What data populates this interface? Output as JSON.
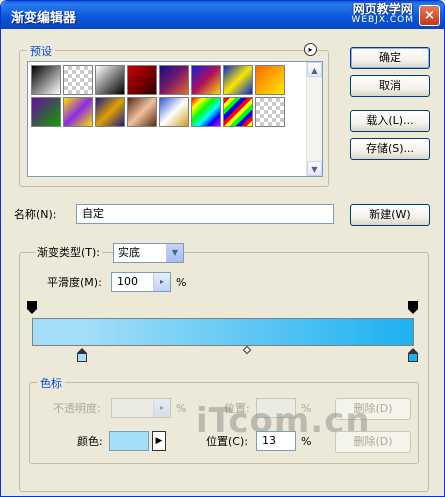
{
  "window": {
    "title": "渐变编辑器",
    "close_glyph": "×",
    "watermark_cn": "网页教学网",
    "watermark_url": "WEBJX.COM"
  },
  "presets": {
    "label": "预设",
    "menu_glyph": "▸",
    "scroll_up_glyph": "▲",
    "scroll_down_glyph": "▼",
    "swatches": [
      "linear-gradient(135deg,#000,#fff)",
      "repeating-conic-gradient(#ccc 0 25%,#fff 0 50%) 0 0/8px 8px",
      "linear-gradient(135deg,#fff,#000)",
      "linear-gradient(135deg,#c00,#300)",
      "linear-gradient(135deg,#140a8a,#7a1a6a,#e86b2b)",
      "linear-gradient(135deg,#1b1bd9,#b0105a,#f7dc00)",
      "linear-gradient(135deg,#0026d6,#f8e800,#0026d6)",
      "linear-gradient(135deg,#ff6a00,#ffe800)",
      "linear-gradient(135deg,#6a0aa0,#10a000)",
      "linear-gradient(135deg,#ffe000,#8a2be2,#ffe000)",
      "linear-gradient(135deg,#1a1a8a,#e0a000,#1a1a8a)",
      "linear-gradient(135deg,#5a2a10,#f0c0a0,#5a2a10)",
      "linear-gradient(135deg,#2a5ad0,#fff,#d09a20)",
      "linear-gradient(135deg,#f00,#ff0,#0f0,#0ff,#00f,#f0f)",
      "repeating-linear-gradient(135deg,#f00 0 4px,#ff0 4px 8px,#0f0 8px 12px,#00f 12px 16px)",
      "repeating-conic-gradient(#ccc 0 25%,#fff 0 50%) 0 0/8px 8px"
    ]
  },
  "buttons": {
    "ok": "确定",
    "cancel": "取消",
    "load": "载入(L)...",
    "save": "存储(S)...",
    "new": "新建(W)"
  },
  "name": {
    "label": "名称(N):",
    "value": "自定"
  },
  "gradient_type": {
    "label": "渐变类型(T):",
    "value": "实底",
    "dropdown_glyph": "▼"
  },
  "smoothness": {
    "label": "平滑度(M):",
    "value": "100",
    "unit": "%",
    "spin_glyph": "▸"
  },
  "gradient": {
    "start_color": "#A4DEF8",
    "end_color": "#1CB1F0",
    "midpoint_percent": 50
  },
  "stops": {
    "label": "色标",
    "opacity_label": "不透明度:",
    "opacity_unit": "%",
    "opacity_position_label": "位置:",
    "opacity_position_unit": "%",
    "opacity_delete": "删除(D)",
    "color_label": "颜色:",
    "color_value": "#A4DEF8",
    "color_menu_glyph": "▶",
    "color_position_label": "位置(C):",
    "color_position_value": "13",
    "color_position_unit": "%",
    "color_delete": "删除(D)"
  },
  "watermark_bottom": "iTcom.cn"
}
